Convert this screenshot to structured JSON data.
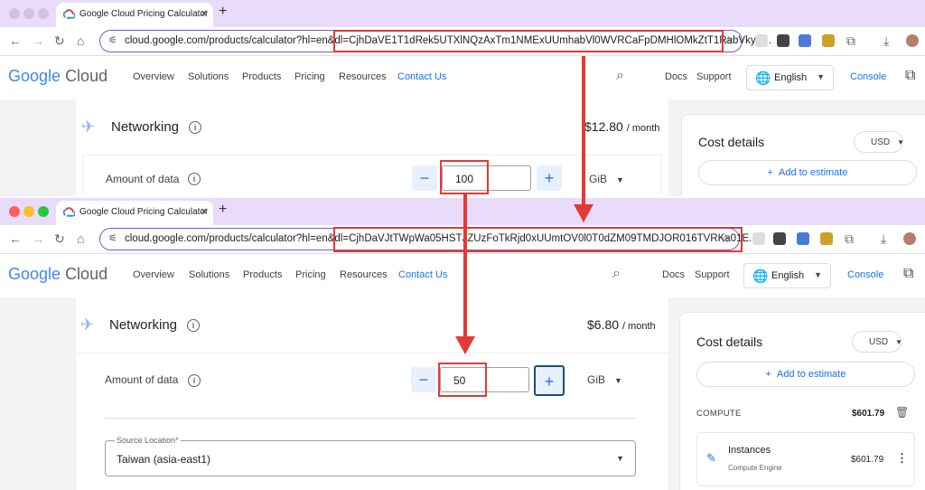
{
  "browser_tab_title": "Google Cloud Pricing Calculator",
  "url_prefix": "cloud.google.com/products/calculator?hl=en&dl=",
  "top": {
    "url_token": "CjhDaVE1T1dRek5UTXlNQzAxTm1NMExUUmhabVl0WVRCaFpDMHlOMkZtT1RabVkyS...",
    "price": "$12.80",
    "amount_value": "100"
  },
  "bottom": {
    "url_token": "CjhDaVJtTWpWa05HSTJZUzFoTkRjd0xUUmtOV0l0T0dZM09TMDJOR016TVRKa01E...",
    "price": "$6.80",
    "amount_value": "50"
  },
  "header": {
    "logo_google": "Google",
    "logo_cloud": "Cloud",
    "nav": [
      "Overview",
      "Solutions",
      "Products",
      "Pricing",
      "Resources",
      "Contact Us"
    ],
    "docs": "Docs",
    "support": "Support",
    "language": "English",
    "console": "Console"
  },
  "section": {
    "title": "Networking",
    "per_month": "/ month",
    "amount_label": "Amount of data",
    "unit": "GiB",
    "source_location_label": "Source Location*",
    "source_location_value": "Taiwan (asia-east1)"
  },
  "cost_details": {
    "title": "Cost details",
    "currency": "USD",
    "add_to_estimate": "Add to estimate",
    "compute_label": "COMPUTE",
    "compute_total": "$601.79",
    "item_name": "Instances",
    "item_sub": "Compute Engine",
    "item_price": "$601.79"
  },
  "colors": {
    "tabbar": "#e9dbfa",
    "highlight": "#e53935",
    "accent": "#1a73e8",
    "page_bg": "#f1f3f4"
  }
}
